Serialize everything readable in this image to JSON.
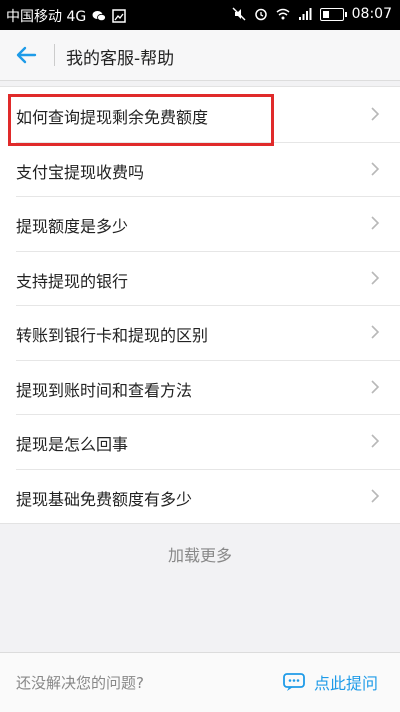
{
  "status_bar": {
    "carrier": "中国移动 4G",
    "time": "08:07"
  },
  "header": {
    "title": "我的客服-帮助"
  },
  "help_items": [
    {
      "label": "如何查询提现剩余免费额度"
    },
    {
      "label": "支付宝提现收费吗"
    },
    {
      "label": "提现额度是多少"
    },
    {
      "label": "支持提现的银行"
    },
    {
      "label": "转账到银行卡和提现的区别"
    },
    {
      "label": "提现到账时间和查看方法"
    },
    {
      "label": "提现是怎么回事"
    },
    {
      "label": "提现基础免费额度有多少"
    }
  ],
  "load_more_label": "加载更多",
  "footer": {
    "question": "还没解决您的问题?",
    "ask_label": "点此提问"
  },
  "colors": {
    "accent": "#1e9be8",
    "highlight": "#e02a2a"
  }
}
